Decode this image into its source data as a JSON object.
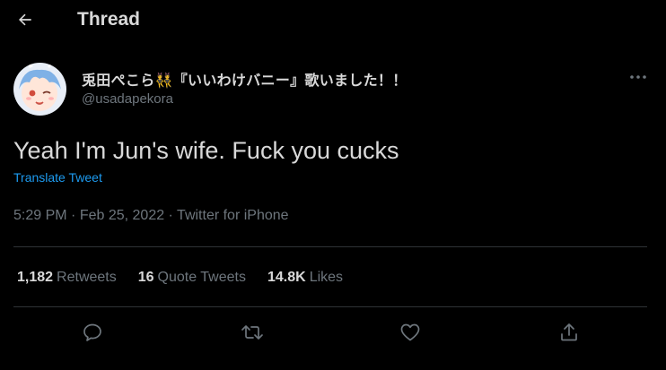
{
  "header": {
    "title": "Thread",
    "back_icon": "arrow-left-icon"
  },
  "tweet": {
    "author": {
      "display_name": "兎田ぺこら👯『いいわけバニー』歌いました！！",
      "handle": "@usadapekora"
    },
    "text": "Yeah I'm Jun's wife. Fuck you cucks",
    "translate_label": "Translate Tweet",
    "time": "5:29 PM",
    "date": "Feb 25, 2022",
    "source": "Twitter for iPhone",
    "separator": " · "
  },
  "stats": {
    "retweets": {
      "count": "1,182",
      "label": "Retweets"
    },
    "quotes": {
      "count": "16",
      "label": "Quote Tweets"
    },
    "likes": {
      "count": "14.8K",
      "label": "Likes"
    }
  },
  "actions": [
    {
      "name": "reply",
      "icon": "speech-bubble-icon"
    },
    {
      "name": "retweet",
      "icon": "retweet-arrows-icon"
    },
    {
      "name": "like",
      "icon": "heart-icon"
    },
    {
      "name": "share",
      "icon": "share-upload-icon"
    }
  ],
  "colors": {
    "background": "#000000",
    "text": "#d9d9d9",
    "secondary": "#6e767d",
    "link": "#1d9bf0",
    "divider": "#2f3336"
  }
}
